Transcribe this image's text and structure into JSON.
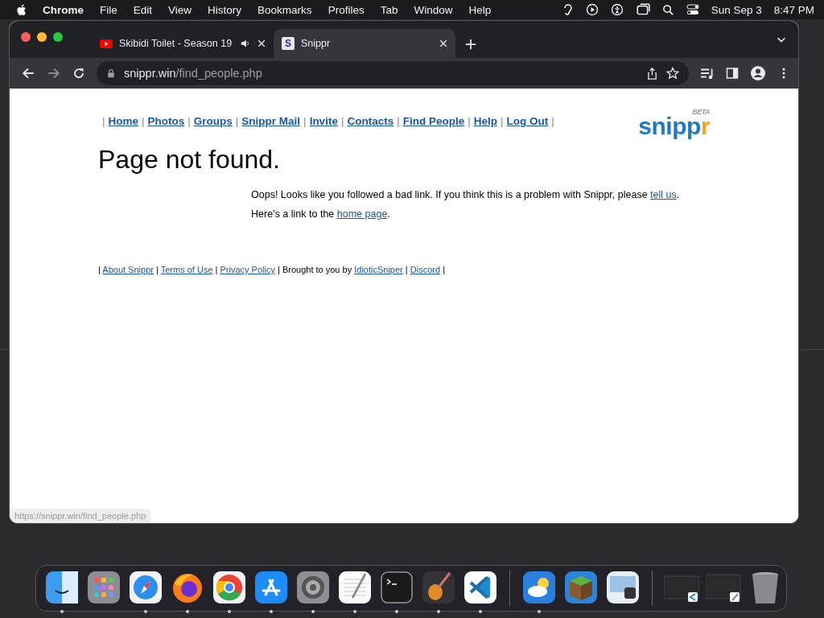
{
  "menu_bar": {
    "app": "Chrome",
    "items": [
      "File",
      "Edit",
      "View",
      "History",
      "Bookmarks",
      "Profiles",
      "Tab",
      "Window",
      "Help"
    ],
    "date": "Sun Sep 3",
    "time": "8:47 PM"
  },
  "tabs": [
    {
      "kind": "youtube",
      "title": "Skibidi Toilet - Season 19",
      "audio": true,
      "selected": false
    },
    {
      "kind": "letter",
      "favicon": "S",
      "title": "Snippr",
      "audio": false,
      "selected": true
    }
  ],
  "address_bar": {
    "host": "snippr.win",
    "path": "/find_people.php"
  },
  "page": {
    "nav": {
      "separator": "|",
      "links": [
        "Home",
        "Photos",
        "Groups",
        "Snippr Mail",
        "Invite",
        "Contacts",
        "Find People",
        "Help",
        "Log Out"
      ]
    },
    "logo": {
      "text": "snippr",
      "badge": "BETA"
    },
    "heading": "Page not found.",
    "paragraphs": [
      {
        "before": "Oops! Looks like you followed a bad link. If you think this is a problem with Snippr, please ",
        "link": "tell us",
        "after": "."
      },
      {
        "before": "Here’s a link to the ",
        "link": "home page",
        "after": "."
      }
    ],
    "footer": {
      "separator": "|",
      "items": [
        {
          "kind": "link",
          "text": "About Snippr"
        },
        {
          "kind": "link",
          "text": "Terms of Use"
        },
        {
          "kind": "link",
          "text": "Privacy Policy"
        },
        {
          "kind": "credit",
          "text": "Brought to you by",
          "link": "IdioticSniper"
        },
        {
          "kind": "link",
          "text": "Discord"
        }
      ]
    },
    "status_url": "https://snippr.win/find_people.php"
  },
  "dock": [
    {
      "kind": "finder",
      "running": true
    },
    {
      "kind": "launchpad",
      "running": false
    },
    {
      "kind": "safari",
      "running": true
    },
    {
      "kind": "firefox",
      "running": true
    },
    {
      "kind": "chrome",
      "running": true
    },
    {
      "kind": "appstore",
      "running": true
    },
    {
      "kind": "settings",
      "running": true
    },
    {
      "kind": "textedit",
      "running": true
    },
    {
      "kind": "terminal",
      "running": true
    },
    {
      "kind": "garageband",
      "running": true
    },
    {
      "kind": "vscode",
      "running": true
    },
    {
      "kind": "divider"
    },
    {
      "kind": "weather",
      "running": true
    },
    {
      "kind": "minecraft",
      "running": false
    },
    {
      "kind": "preview",
      "running": false
    },
    {
      "kind": "divider"
    },
    {
      "kind": "window",
      "running": false
    },
    {
      "kind": "window2",
      "running": false
    },
    {
      "kind": "trash",
      "running": false
    }
  ]
}
